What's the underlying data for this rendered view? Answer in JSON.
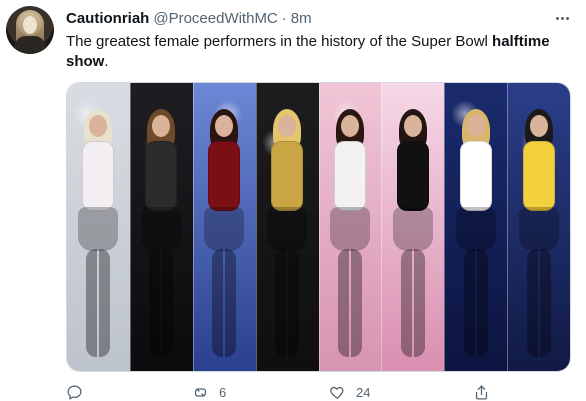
{
  "tweet": {
    "author_name": "Cautionriah",
    "handle": "@ProceedWithMC",
    "separator": "·",
    "time": "8m",
    "text_main": "The greatest female performers in the history of the Super Bowl ",
    "text_bold": "halftime",
    "text_bold2": "show",
    "text_end": ".",
    "media": {
      "panels": [
        {
          "bg_top": "#d9dde3",
          "bg_bottom": "#bdc3cc",
          "accent": "#f3eef2",
          "hair": "#e8e1cf"
        },
        {
          "bg_top": "#1e1e22",
          "bg_bottom": "#0b0b0d",
          "accent": "#2b2b2b",
          "hair": "#6f4a2a"
        },
        {
          "bg_top": "#6d88d6",
          "bg_bottom": "#2b3f8f",
          "accent": "#7a0f16",
          "hair": "#2a1410"
        },
        {
          "bg_top": "#1d1d1f",
          "bg_bottom": "#0f0f10",
          "accent": "#c9a544",
          "hair": "#e5c56c"
        },
        {
          "bg_top": "#f0c5d6",
          "bg_bottom": "#d794b1",
          "accent": "#f3f1f3",
          "hair": "#2a1712"
        },
        {
          "bg_top": "#f6d8e6",
          "bg_bottom": "#d98fb0",
          "accent": "#111111",
          "hair": "#231512"
        },
        {
          "bg_top": "#1a2b6d",
          "bg_bottom": "#0d1440",
          "accent": "#ffffff",
          "hair": "#d8b56a"
        },
        {
          "bg_top": "#2b3e8a",
          "bg_bottom": "#111a45",
          "accent": "#f3d03e",
          "hair": "#1c1a1a"
        }
      ]
    },
    "actions": {
      "reply_count": "",
      "retweet_count": "6",
      "like_count": "24",
      "share_count": ""
    }
  }
}
